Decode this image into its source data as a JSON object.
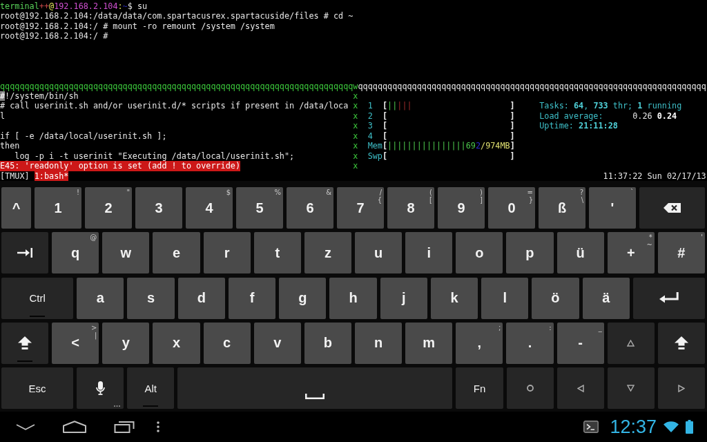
{
  "terminal": {
    "shell_lines": [
      {
        "kind": "text",
        "segments": [
          {
            "text": "terminal",
            "kind": "user"
          },
          {
            "text": "++",
            "kind": "plus"
          },
          {
            "text": "@",
            "kind": "at"
          },
          {
            "text": "192.168.2.104",
            "kind": "host"
          },
          {
            "text": ":",
            "kind": "at"
          },
          {
            "text": "~",
            "kind": "path"
          },
          {
            "text": "$ su",
            "kind": "text"
          }
        ]
      },
      {
        "kind": "text",
        "segments": [
          {
            "text": "root@192.168.2.104:/data/data/com.spartacusrex.spartacuside/files # cd ~",
            "kind": "text"
          }
        ]
      },
      {
        "kind": "text",
        "segments": [
          {
            "text": "root@192.168.2.104:/ # mount -ro remount /system /system",
            "kind": "text"
          }
        ]
      },
      {
        "kind": "text",
        "segments": [
          {
            "text": "root@192.168.2.104:/ #",
            "kind": "text"
          }
        ]
      }
    ],
    "separator": [
      {
        "text": "qqqqqqqqqqqqqqqqqqqqqqqqqqqqqqqqqqqqqqqqqqqqqqqqqqqqqqqqqqqqqqqqqqqqqqqqw",
        "kind": "active"
      },
      {
        "text": "qqqqqqqqqqqqqqqqqqqqqqqqqqqqqqqqqqqqqqqqqqqqqqqqqqqqqqqqqqqqqqqqqqqqqqq",
        "kind": "border"
      }
    ],
    "editor_lines": [
      {
        "kind": "text",
        "segments": [
          {
            "text": "#",
            "kind": "cursor"
          },
          {
            "text": "!/system/bin/sh",
            "kind": "text"
          }
        ]
      },
      {
        "kind": "text",
        "segments": [
          {
            "text": "# call userinit.sh and/or userinit.d/* scripts if present in /data/loca",
            "kind": "text"
          }
        ]
      },
      {
        "kind": "text",
        "segments": [
          {
            "text": "l",
            "kind": "text"
          }
        ]
      },
      {
        "kind": "blank"
      },
      {
        "kind": "text",
        "segments": [
          {
            "text": "if [ -e /data/local/userinit.sh ];",
            "kind": "text"
          }
        ]
      },
      {
        "kind": "text",
        "segments": [
          {
            "text": "then",
            "kind": "text"
          }
        ]
      },
      {
        "kind": "text",
        "segments": [
          {
            "text": "   log -p i -t userinit \"Executing /data/local/userinit.sh\";",
            "kind": "text"
          }
        ]
      },
      {
        "kind": "error",
        "segments": [
          {
            "text": "E45: 'readonly' option is set (add ! to override)",
            "kind": "text"
          }
        ]
      }
    ],
    "divider": "xxxxxxxx",
    "meters": [
      {
        "segments": [
          {
            "text": "1",
            "kind": "label"
          },
          {
            "text": "[",
            "kind": "open"
          },
          {
            "text": "||",
            "kind": "used"
          },
          {
            "text": "|||",
            "kind": "kernel"
          },
          {
            "text": "]",
            "kind": "close"
          }
        ]
      },
      {
        "segments": [
          {
            "text": "2",
            "kind": "label"
          },
          {
            "text": "[",
            "kind": "open"
          },
          {
            "text": "]",
            "kind": "close"
          }
        ]
      },
      {
        "segments": [
          {
            "text": "3",
            "kind": "label"
          },
          {
            "text": "[",
            "kind": "open"
          },
          {
            "text": "]",
            "kind": "close"
          }
        ]
      },
      {
        "segments": [
          {
            "text": "4",
            "kind": "label"
          },
          {
            "text": "[",
            "kind": "open"
          },
          {
            "text": "]",
            "kind": "close"
          }
        ]
      },
      {
        "segments": [
          {
            "text": "Mem",
            "kind": "label"
          },
          {
            "text": "[",
            "kind": "open"
          },
          {
            "text": "||||||||||||||||",
            "kind": "used"
          },
          {
            "text": "69",
            "kind": "used"
          },
          {
            "text": "2",
            "kind": "buffer"
          },
          {
            "text": "/974MB",
            "kind": "total"
          },
          {
            "text": "]",
            "kind": "close"
          }
        ]
      },
      {
        "segments": [
          {
            "text": "Swp",
            "kind": "label"
          },
          {
            "text": "[",
            "kind": "open"
          },
          {
            "text": "]",
            "kind": "close"
          }
        ]
      }
    ],
    "summary": [
      {
        "segments": [
          {
            "text": "Tasks: ",
            "kind": "label"
          },
          {
            "text": "64",
            "kind": "value"
          },
          {
            "text": ", ",
            "kind": "label"
          },
          {
            "text": "733",
            "kind": "value"
          },
          {
            "text": " thr; ",
            "kind": "label"
          },
          {
            "text": "1",
            "kind": "value"
          },
          {
            "text": " running",
            "kind": "label"
          }
        ]
      },
      {
        "segments": [
          {
            "text": "Load average:",
            "kind": "label"
          },
          {
            "text": "      0.26 ",
            "kind": "load"
          },
          {
            "text": "0.24",
            "kind": "strong"
          }
        ]
      },
      {
        "segments": [
          {
            "text": "Uptime: ",
            "kind": "label"
          },
          {
            "text": "21:11:28",
            "kind": "value"
          }
        ]
      }
    ],
    "status": {
      "session": "[TMUX]",
      "windows": [
        {
          "label": "1:bash*",
          "selected": true
        }
      ],
      "clock": "11:37:22 Sun 02/17/13"
    }
  },
  "keyboard": {
    "rows": [
      {
        "keys": [
          {
            "kind": "char",
            "label": "^"
          },
          {
            "kind": "char",
            "label": "1",
            "hints": [
              "!"
            ]
          },
          {
            "kind": "char",
            "label": "2",
            "hints": [
              "\""
            ]
          },
          {
            "kind": "char",
            "label": "3"
          },
          {
            "kind": "char",
            "label": "4",
            "hints": [
              "$"
            ]
          },
          {
            "kind": "char",
            "label": "5",
            "hints": [
              "%"
            ]
          },
          {
            "kind": "char",
            "label": "6",
            "hints": [
              "&"
            ]
          },
          {
            "kind": "char",
            "label": "7",
            "hints": [
              "/",
              "{"
            ]
          },
          {
            "kind": "char",
            "label": "8",
            "hints": [
              "(",
              "["
            ]
          },
          {
            "kind": "char",
            "label": "9",
            "hints": [
              ")",
              "]"
            ]
          },
          {
            "kind": "char",
            "label": "0",
            "hints": [
              "=",
              "}"
            ]
          },
          {
            "kind": "char",
            "label": "ß",
            "hints": [
              "?",
              "\\"
            ]
          },
          {
            "kind": "char",
            "label": "'",
            "hints": [
              "`"
            ]
          },
          {
            "kind": "backspace"
          }
        ]
      },
      {
        "keys": [
          {
            "kind": "tab"
          },
          {
            "kind": "char",
            "label": "q",
            "hints": [
              "@"
            ]
          },
          {
            "kind": "char",
            "label": "w"
          },
          {
            "kind": "char",
            "label": "e"
          },
          {
            "kind": "char",
            "label": "r"
          },
          {
            "kind": "char",
            "label": "t"
          },
          {
            "kind": "char",
            "label": "z"
          },
          {
            "kind": "char",
            "label": "u"
          },
          {
            "kind": "char",
            "label": "i"
          },
          {
            "kind": "char",
            "label": "o"
          },
          {
            "kind": "char",
            "label": "p"
          },
          {
            "kind": "char",
            "label": "ü"
          },
          {
            "kind": "char",
            "label": "+",
            "hints": [
              "*",
              "~"
            ]
          },
          {
            "kind": "char",
            "label": "#",
            "hints": [
              "'"
            ]
          }
        ]
      },
      {
        "keys": [
          {
            "kind": "mod",
            "label": "Ctrl",
            "indicator": true
          },
          {
            "kind": "char",
            "label": "a"
          },
          {
            "kind": "char",
            "label": "s"
          },
          {
            "kind": "char",
            "label": "d"
          },
          {
            "kind": "char",
            "label": "f"
          },
          {
            "kind": "char",
            "label": "g"
          },
          {
            "kind": "char",
            "label": "h"
          },
          {
            "kind": "char",
            "label": "j"
          },
          {
            "kind": "char",
            "label": "k"
          },
          {
            "kind": "char",
            "label": "l"
          },
          {
            "kind": "char",
            "label": "ö"
          },
          {
            "kind": "char",
            "label": "ä"
          },
          {
            "kind": "enter"
          }
        ]
      },
      {
        "keys": [
          {
            "kind": "shift",
            "indicator": true
          },
          {
            "kind": "char",
            "label": "<",
            "hints": [
              ">",
              "|"
            ]
          },
          {
            "kind": "char",
            "label": "y"
          },
          {
            "kind": "char",
            "label": "x"
          },
          {
            "kind": "char",
            "label": "c"
          },
          {
            "kind": "char",
            "label": "v"
          },
          {
            "kind": "char",
            "label": "b"
          },
          {
            "kind": "char",
            "label": "n"
          },
          {
            "kind": "char",
            "label": "m"
          },
          {
            "kind": "char",
            "label": ",",
            "hints": [
              ";"
            ]
          },
          {
            "kind": "char",
            "label": ".",
            "hints": [
              ":"
            ]
          },
          {
            "kind": "char",
            "label": "-",
            "hints": [
              "_"
            ]
          },
          {
            "kind": "up"
          },
          {
            "kind": "shift",
            "indicator": false
          }
        ]
      },
      {
        "keys": [
          {
            "kind": "mod",
            "label": "Esc"
          },
          {
            "kind": "mic",
            "more": true
          },
          {
            "kind": "mod",
            "label": "Alt",
            "indicator": true
          },
          {
            "kind": "space"
          },
          {
            "kind": "mod",
            "label": "Fn"
          },
          {
            "kind": "circle"
          },
          {
            "kind": "left"
          },
          {
            "kind": "down"
          },
          {
            "kind": "right"
          }
        ]
      }
    ]
  },
  "navbar": {
    "clock": "12:37"
  }
}
